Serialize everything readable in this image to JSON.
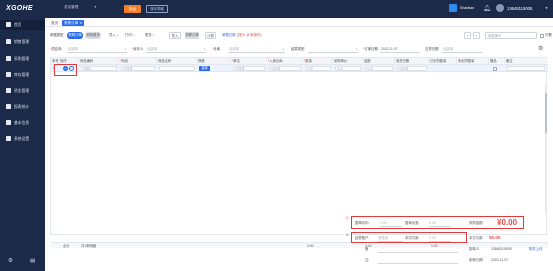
{
  "topbar": {
    "logo": "XGOHE",
    "org_select": "总店管理",
    "btn_primary": "新品",
    "btn_secondary": "快手同城",
    "shop": "Shantlan",
    "phone": "13648115005"
  },
  "sidebar": {
    "items": [
      {
        "label": "首页"
      },
      {
        "label": "销售管理"
      },
      {
        "label": "采购管理"
      },
      {
        "label": "库存管理"
      },
      {
        "label": "资金管理"
      },
      {
        "label": "报表统计"
      },
      {
        "label": "基本信息"
      },
      {
        "label": "系统设置"
      }
    ]
  },
  "tabs": [
    {
      "label": "首页"
    },
    {
      "label": "采购订单 ✕"
    }
  ],
  "toolbar": {
    "label_order": "单据类型",
    "pill_purchase": "采购订单",
    "pill_return": "采购退货",
    "dd_import": "导入",
    "dd_print": "打印",
    "dd_more": "更多",
    "btn_import": "导入",
    "btn_gray": "关联订单",
    "btn_blank": "计算",
    "link_remark": "单据日期",
    "note_red": "(提示: 补单操作)",
    "search_placeholder": "单据编号",
    "checkbox_label": "只看"
  },
  "form": {
    "supplier_label": "供应商",
    "supplier_placeholder": "请选择",
    "handler_label": "经手人",
    "handler_placeholder": "请选择",
    "warehouse_label": "仓库",
    "warehouse_placeholder": "请选择",
    "settle_label": "结算类型",
    "order_date_label": "订单日期",
    "order_date_value": "2023-11-07",
    "delivery_label": "交货日期",
    "delivery_value": "请选择"
  },
  "grid": {
    "columns": [
      "序号",
      "操作",
      "商品编码",
      "商品",
      "商品名称",
      "规格",
      "单位",
      "入库仓库",
      "数量",
      "采购单价",
      "金额",
      "到货日期",
      "已到货数量",
      "未到货数量",
      "赠品",
      "备注"
    ],
    "row": {
      "code_placeholder": "请输入",
      "product_placeholder": "请选择",
      "select_btn": "选择",
      "unit_placeholder": "请选择",
      "warehouse_placeholder": "请选择",
      "qty": "0.00",
      "price": "0.00",
      "amount": "0.00",
      "date_placeholder": "请选择"
    }
  },
  "totals": {
    "label": "合计",
    "count_label": "共1条明细",
    "qty": "0.00",
    "amount": "0.00",
    "arrived": "0.00"
  },
  "summary": {
    "discount_rate_label": "整单折扣:",
    "discount_rate_value": "0.00",
    "discount_amount_label": "整单优惠:",
    "discount_amount_value": "0.00",
    "receivable_label": "采购金额:",
    "receivable_value": "¥0.00",
    "settle_account_label": "结算账户:",
    "settle_account_placeholder": "请选择",
    "paid_label": "本次付款:",
    "paid_value": "0.00",
    "debt_label": "本次欠款:",
    "debt_value": "¥0.00",
    "note_label": "备",
    "note_label2": "注:",
    "maker_label": "制单人:",
    "maker_value": "13648115005",
    "attach_label": "附件上传",
    "date_label": "制单日期:",
    "date_value": "2023-11-07"
  },
  "annotations": {
    "n1": "1.",
    "n2": "2.",
    "n3": "3."
  }
}
